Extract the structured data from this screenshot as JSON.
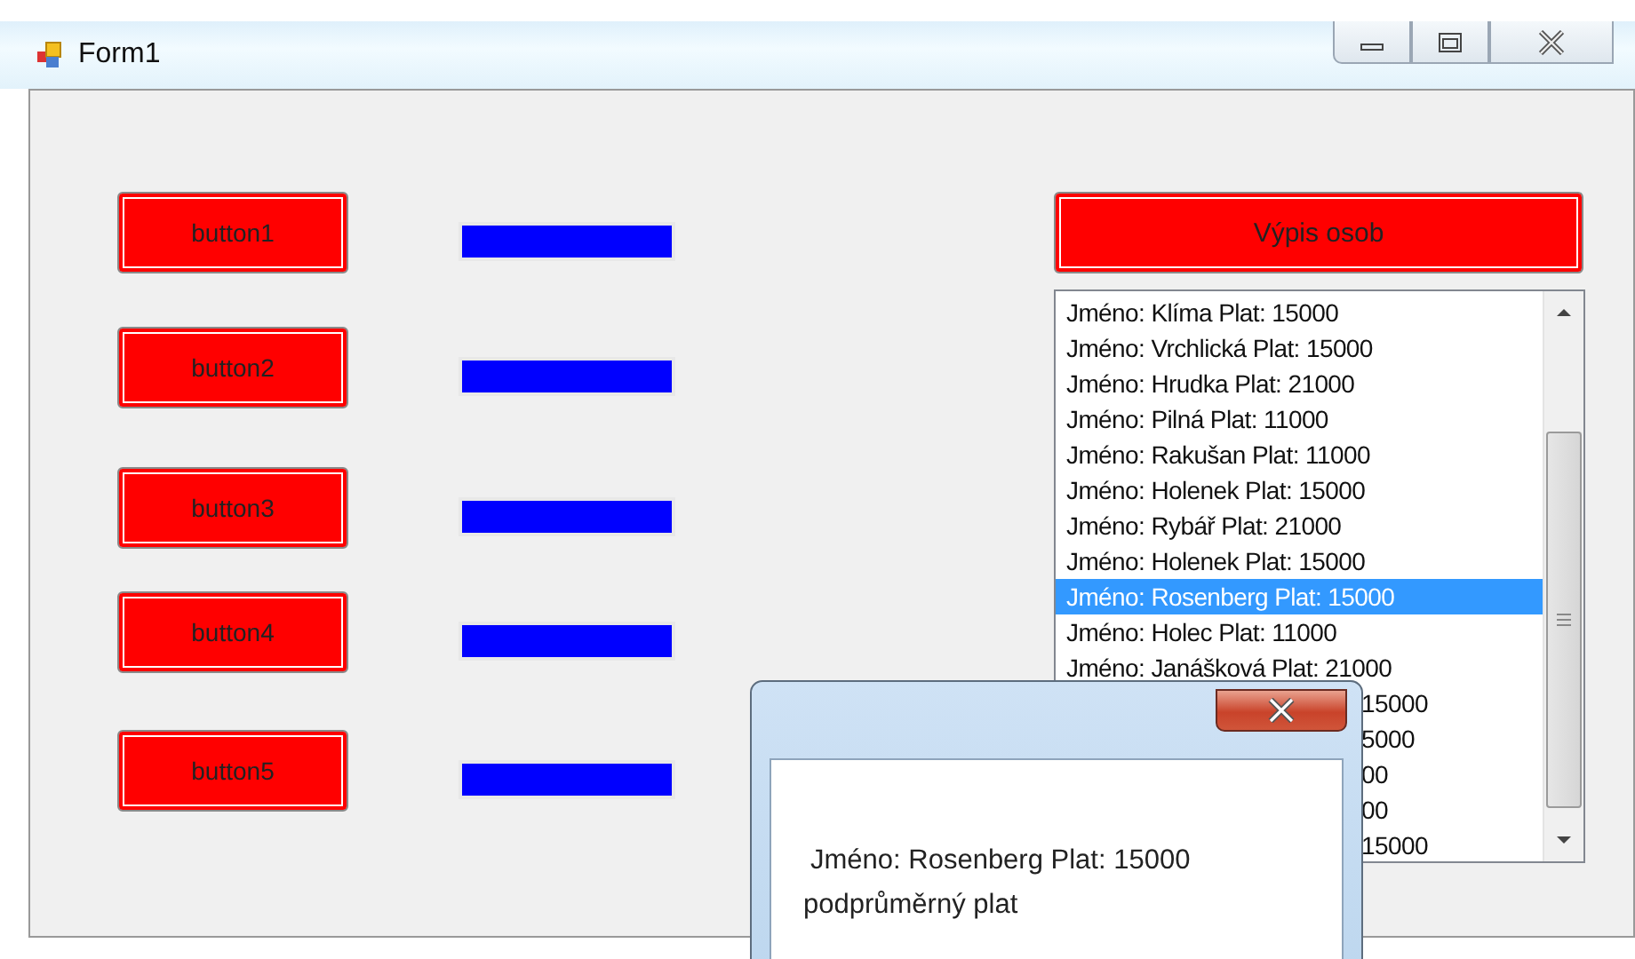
{
  "window": {
    "title": "Form1"
  },
  "buttons": [
    "button1",
    "button2",
    "button3",
    "button4",
    "button5"
  ],
  "list_button": "Výpis osob",
  "list": [
    {
      "text": "Jméno: Klíma Plat: 15000",
      "selected": false,
      "kind": "item"
    },
    {
      "text": "Jméno: Vrchlická Plat: 15000",
      "selected": false,
      "kind": "item"
    },
    {
      "text": "Jméno: Hrudka Plat: 21000",
      "selected": false,
      "kind": "item"
    },
    {
      "text": "Jméno: Pilná Plat: 11000",
      "selected": false,
      "kind": "item"
    },
    {
      "text": "Jméno: Rakušan Plat: 11000",
      "selected": false,
      "kind": "item"
    },
    {
      "text": "Jméno: Holenek Plat: 15000",
      "selected": false,
      "kind": "item"
    },
    {
      "text": "Jméno: Rybář Plat: 21000",
      "selected": false,
      "kind": "item"
    },
    {
      "text": "Jméno: Holenek Plat: 15000",
      "selected": false,
      "kind": "item"
    },
    {
      "text": "Jméno: Rosenberg Plat: 15000",
      "selected": true,
      "kind": "item"
    },
    {
      "text": "Jméno: Holec Plat: 11000",
      "selected": false,
      "kind": "item"
    },
    {
      "text": "Jméno: Janášková Plat: 21000",
      "selected": false,
      "kind": "item"
    },
    {
      "text": "15000",
      "selected": false,
      "kind": "covered"
    },
    {
      "text": "5000",
      "selected": false,
      "kind": "covered"
    },
    {
      "text": "00",
      "selected": false,
      "kind": "covered"
    },
    {
      "text": "00",
      "selected": false,
      "kind": "covered"
    },
    {
      "text": "15000",
      "selected": false,
      "kind": "covered"
    }
  ],
  "dialog": {
    "lines": [
      "Jméno: Rosenberg Plat: 15000",
      "podprůměrný plat"
    ]
  }
}
